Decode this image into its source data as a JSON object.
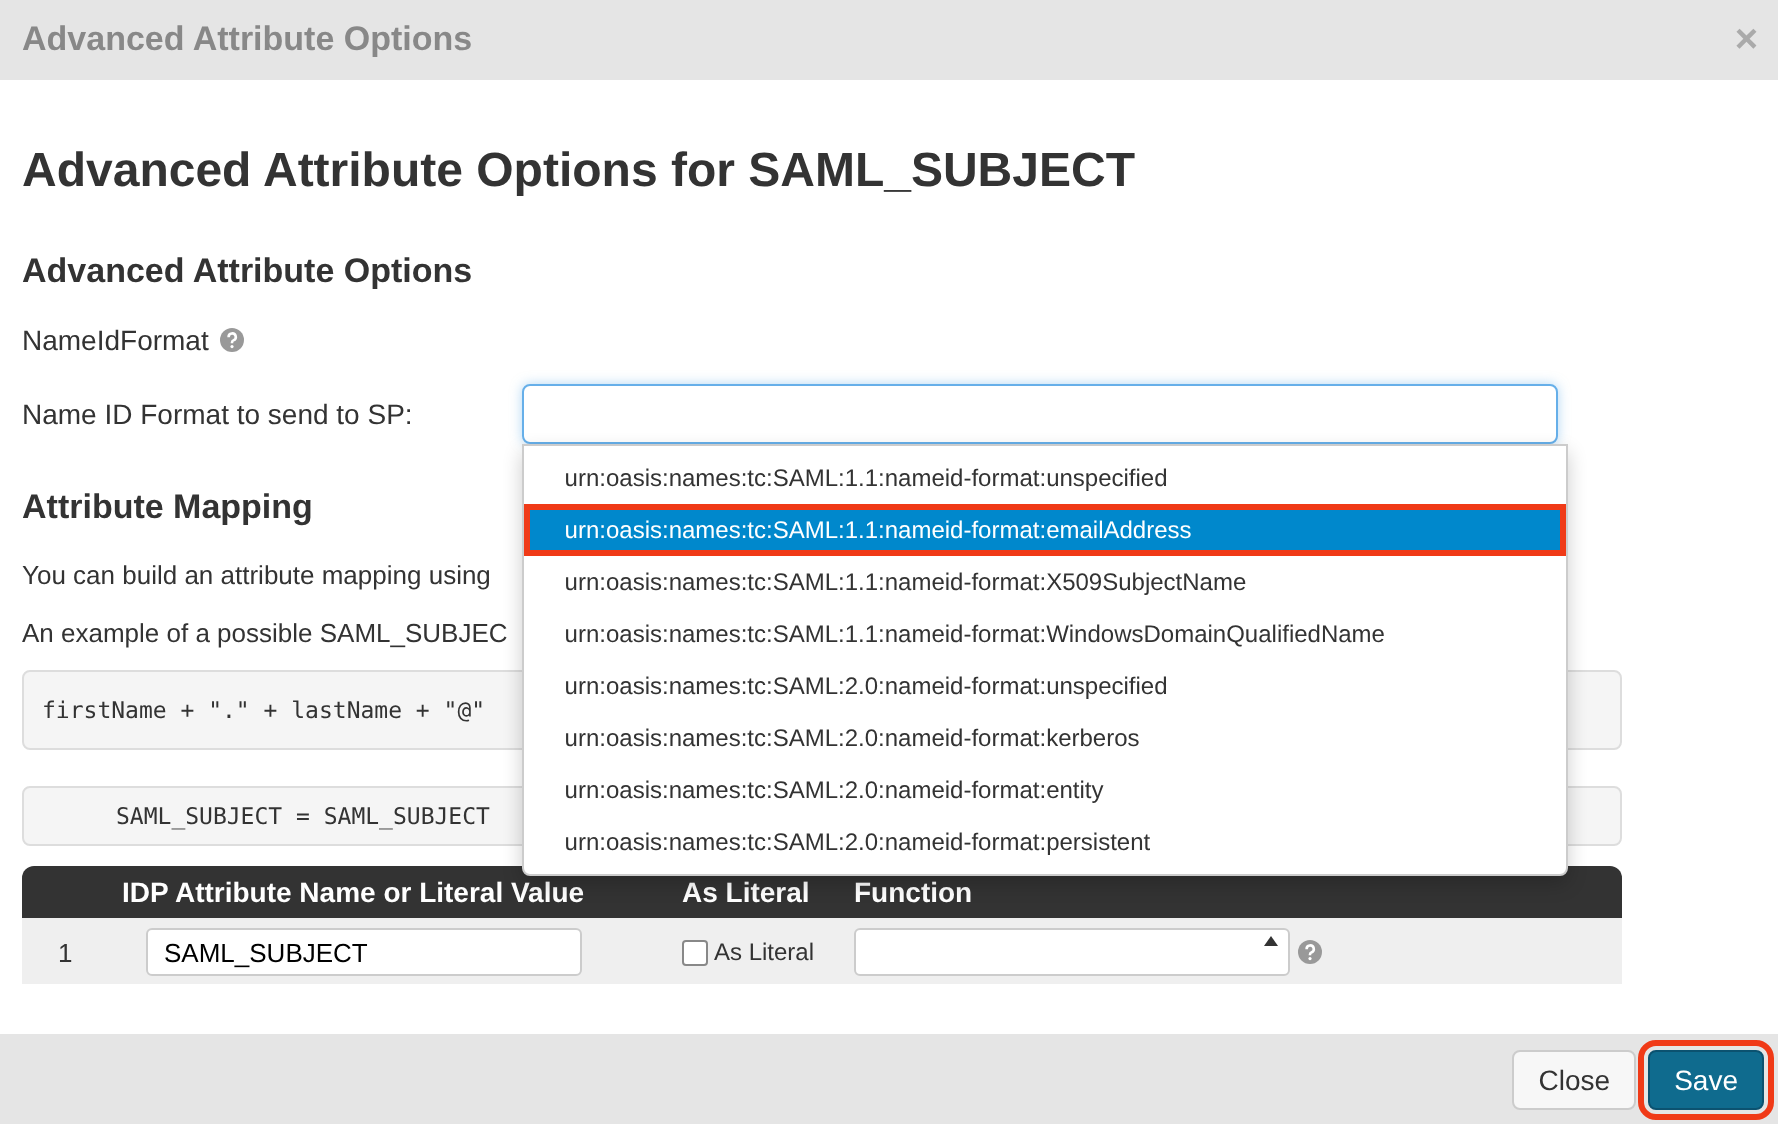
{
  "window": {
    "title": "Advanced Attribute Options",
    "close": "×"
  },
  "heading": "Advanced Attribute Options for SAML_SUBJECT",
  "section_options": {
    "title": "Advanced Attribute Options",
    "name_id_format_label": "NameIdFormat",
    "field_label": "Name ID Format to send to SP:"
  },
  "dropdown": [
    {
      "label": "urn:oasis:names:tc:SAML:1.1:nameid-format:unspecified",
      "selected": false
    },
    {
      "label": "urn:oasis:names:tc:SAML:1.1:nameid-format:emailAddress",
      "selected": true
    },
    {
      "label": "urn:oasis:names:tc:SAML:1.1:nameid-format:X509SubjectName",
      "selected": false
    },
    {
      "label": "urn:oasis:names:tc:SAML:1.1:nameid-format:WindowsDomainQualifiedName",
      "selected": false
    },
    {
      "label": "urn:oasis:names:tc:SAML:2.0:nameid-format:unspecified",
      "selected": false
    },
    {
      "label": "urn:oasis:names:tc:SAML:2.0:nameid-format:kerberos",
      "selected": false
    },
    {
      "label": "urn:oasis:names:tc:SAML:2.0:nameid-format:entity",
      "selected": false
    },
    {
      "label": "urn:oasis:names:tc:SAML:2.0:nameid-format:persistent",
      "selected": false
    }
  ],
  "section_mapping": {
    "title": "Attribute Mapping",
    "paragraphs": [
      "You can build an attribute mapping using",
      "An example of a possible SAML_SUBJEC"
    ],
    "code_example": "firstName + \".\" + lastName + \"@\"",
    "code_result": "SAML_SUBJECT = SAML_SUBJECT"
  },
  "table": {
    "columns": [
      "IDP Attribute Name or Literal Value",
      "As Literal",
      "Function"
    ],
    "rows": [
      {
        "number": "1",
        "value": "SAML_SUBJECT",
        "literal_label": "As Literal",
        "checked": false
      }
    ]
  },
  "buttons": [
    {
      "label": "Close",
      "kind": "default",
      "highlighted": false
    },
    {
      "label": "Save",
      "kind": "primary",
      "highlighted": true
    }
  ]
}
